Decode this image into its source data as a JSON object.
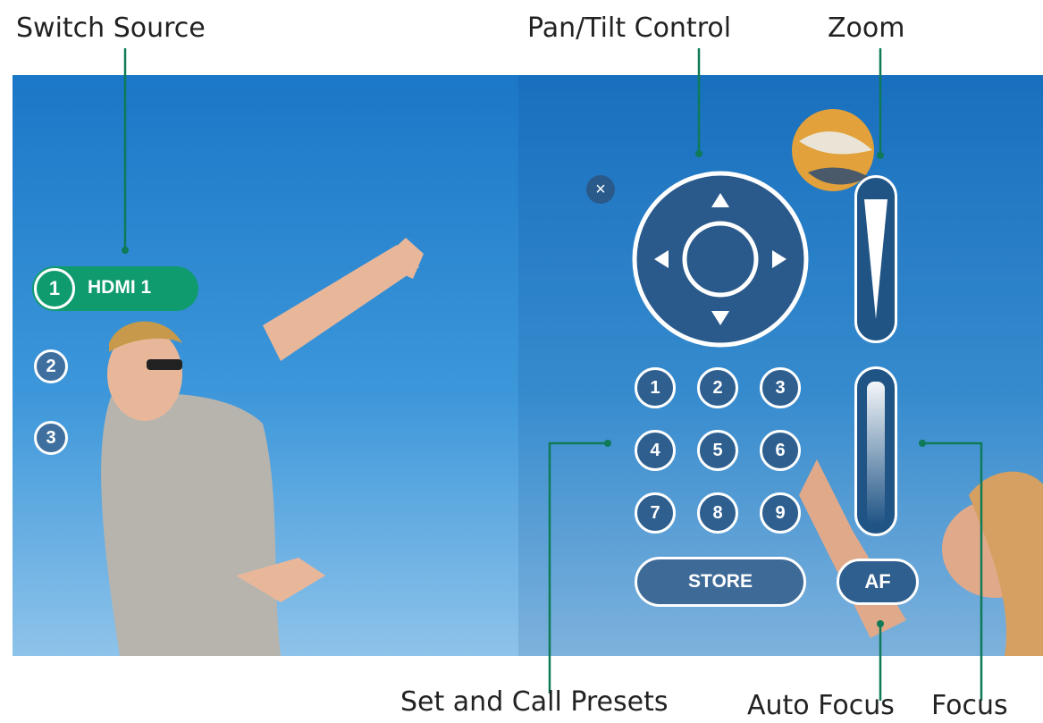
{
  "callouts": {
    "switch_source": "Switch Source",
    "pan_tilt": "Pan/Tilt Control",
    "zoom": "Zoom",
    "presets": "Set and Call Presets",
    "auto_focus": "Auto Focus",
    "focus": "Focus"
  },
  "sources": {
    "active": {
      "number": "1",
      "label": "HDMI 1"
    },
    "others": [
      "2",
      "3"
    ]
  },
  "close_icon": "×",
  "presets": [
    "1",
    "2",
    "3",
    "4",
    "5",
    "6",
    "7",
    "8",
    "9"
  ],
  "store_label": "STORE",
  "af_label": "AF",
  "colors": {
    "accent": "#0f9b6e",
    "callout_line": "#0f7a57",
    "control_fill": "#2e5f8f",
    "sky_top": "#1b77c7",
    "sky_bottom": "#8ec3ea"
  },
  "icons": [
    "close-icon",
    "arrow-up-icon",
    "arrow-down-icon",
    "arrow-left-icon",
    "arrow-right-icon"
  ]
}
